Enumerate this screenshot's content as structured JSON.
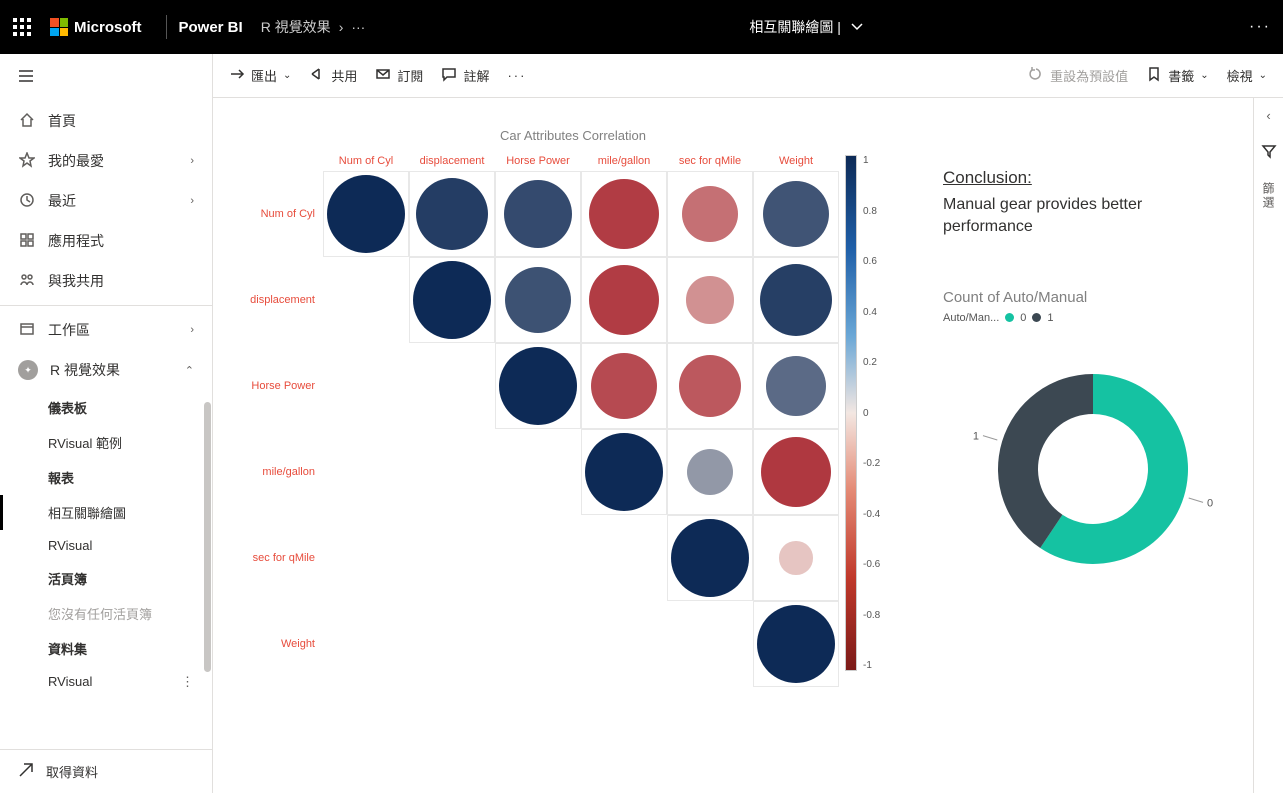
{
  "topbar": {
    "ms_label": "Microsoft",
    "app_label": "Power BI",
    "breadcrumb_item": "R 視覺效果",
    "breadcrumb_sep": "›",
    "breadcrumb_ellipsis": "···",
    "report_title": "相互關聯繪圖  |",
    "more": "···"
  },
  "sidebar": {
    "items": [
      {
        "icon": "home",
        "label": "首頁"
      },
      {
        "icon": "star",
        "label": "我的最愛",
        "chevron": true
      },
      {
        "icon": "clock",
        "label": "最近",
        "chevron": true
      },
      {
        "icon": "apps",
        "label": "應用程式"
      },
      {
        "icon": "share",
        "label": "與我共用"
      },
      {
        "icon": "workspace",
        "label": "工作區",
        "chevron": true
      }
    ],
    "workspace": {
      "label": "R 視覺效果",
      "sections": [
        {
          "header": "儀表板",
          "items": [
            "RVisual 範例"
          ]
        },
        {
          "header": "報表",
          "items_active": "相互關聯繪圖",
          "items": [
            "RVisual"
          ]
        },
        {
          "header": "活頁簿",
          "empty_text": "您沒有任何活頁簿"
        },
        {
          "header": "資料集",
          "items": [
            "RVisual"
          ]
        }
      ]
    },
    "footer": "取得資料"
  },
  "toolbar": {
    "export": "匯出",
    "share": "共用",
    "subscribe": "訂閱",
    "comment": "註解",
    "more": "···",
    "reset": "重設為預設值",
    "bookmarks": "書籤",
    "view": "檢視"
  },
  "chart_data": [
    {
      "type": "heatmap",
      "title": "Car Attributes Correlation",
      "vars": [
        "Num of Cyl",
        "displacement",
        "Horse Power",
        "mile/gallon",
        "sec for qMile",
        "Weight"
      ],
      "matrix": [
        [
          1.0,
          0.9,
          0.83,
          -0.85,
          -0.59,
          0.78
        ],
        [
          null,
          1.0,
          0.79,
          -0.85,
          -0.43,
          0.89
        ],
        [
          null,
          null,
          1.0,
          -0.78,
          -0.71,
          0.66
        ],
        [
          null,
          null,
          null,
          1.0,
          0.42,
          -0.87
        ],
        [
          null,
          null,
          null,
          null,
          1.0,
          -0.17
        ],
        [
          null,
          null,
          null,
          null,
          null,
          1.0
        ]
      ],
      "colorbar_ticks": [
        "1",
        "0.8",
        "0.6",
        "0.4",
        "0.2",
        "0",
        "-0.2",
        "-0.4",
        "-0.6",
        "-0.8",
        "-1"
      ]
    },
    {
      "type": "pie",
      "title": "Count of Auto/Manual",
      "legend_label": "Auto/Man...",
      "series": [
        {
          "name": "0",
          "value": 19,
          "color": "#15c2a2"
        },
        {
          "name": "1",
          "value": 13,
          "color": "#3c4852"
        }
      ],
      "donut": true
    }
  ],
  "conclusion": {
    "heading": "Conclusion: ",
    "body": "Manual gear provides better performance"
  },
  "side_panel": {
    "label": "篩選"
  }
}
